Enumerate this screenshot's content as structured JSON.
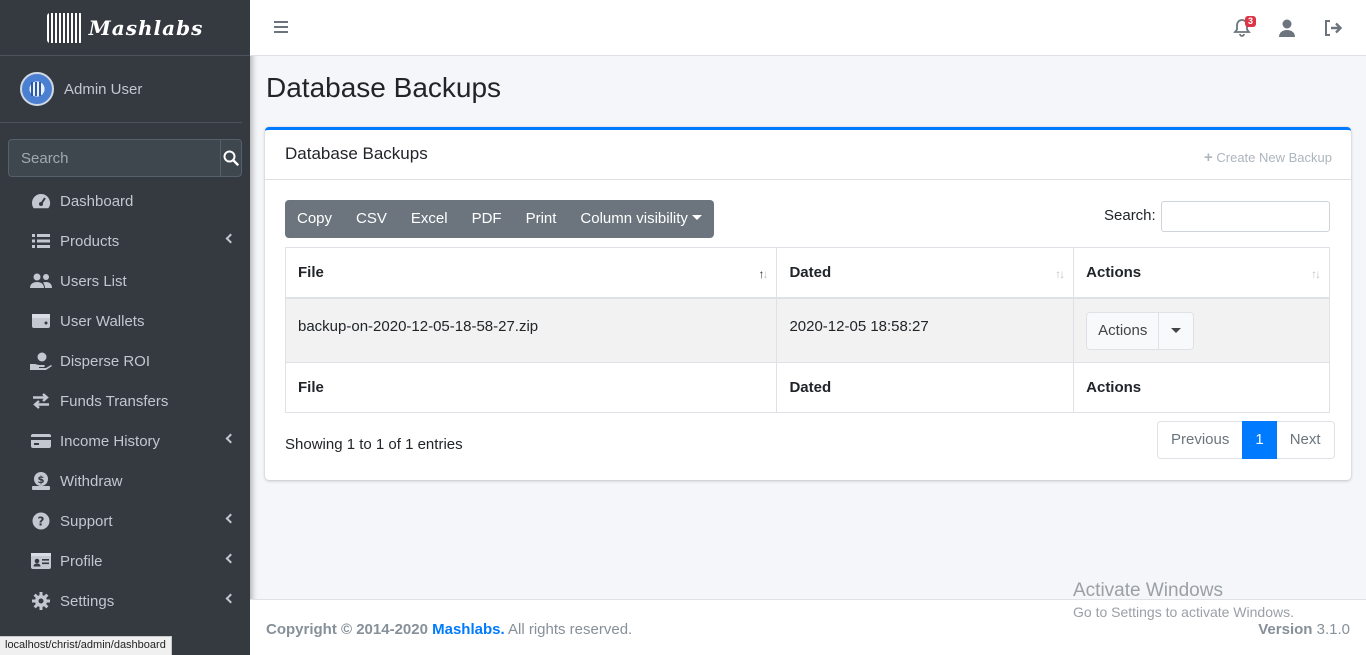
{
  "brand": {
    "name": "Mashlabs"
  },
  "user": {
    "name": "Admin User"
  },
  "sidebar": {
    "search_placeholder": "Search",
    "items": [
      {
        "label": "Dashboard",
        "icon": "tachometer-icon",
        "submenu": false
      },
      {
        "label": "Products",
        "icon": "list-icon",
        "submenu": true
      },
      {
        "label": "Users List",
        "icon": "users-icon",
        "submenu": false
      },
      {
        "label": "User Wallets",
        "icon": "wallet-icon",
        "submenu": false
      },
      {
        "label": "Disperse ROI",
        "icon": "hand-holding-usd-icon",
        "submenu": false
      },
      {
        "label": "Funds Transfers",
        "icon": "exchange-icon",
        "submenu": false
      },
      {
        "label": "Income History",
        "icon": "credit-card-icon",
        "submenu": true
      },
      {
        "label": "Withdraw",
        "icon": "money-bill-icon",
        "submenu": false
      },
      {
        "label": "Support",
        "icon": "question-circle-icon",
        "submenu": true
      },
      {
        "label": "Profile",
        "icon": "id-card-icon",
        "submenu": true
      },
      {
        "label": "Settings",
        "icon": "cog-icon",
        "submenu": true
      }
    ]
  },
  "topbar": {
    "notification_count": "3"
  },
  "page": {
    "title": "Database Backups"
  },
  "card": {
    "title": "Database Backups",
    "create_label": "Create New Backup",
    "buttons": [
      "Copy",
      "CSV",
      "Excel",
      "PDF",
      "Print",
      "Column visibility"
    ],
    "search_label": "Search:",
    "columns": [
      "File",
      "Dated",
      "Actions"
    ],
    "rows": [
      {
        "file": "backup-on-2020-12-05-18-58-27.zip",
        "dated": "2020-12-05 18:58:27",
        "action_label": "Actions"
      }
    ],
    "info": "Showing 1 to 1 of 1 entries",
    "pagination": {
      "previous": "Previous",
      "current": "1",
      "next": "Next"
    }
  },
  "footer": {
    "copyright": "Copyright © 2014-2020",
    "brand": "Mashlabs.",
    "rights": "All rights reserved.",
    "version_label": "Version",
    "version": "3.1.0"
  },
  "watermark": {
    "title": "Activate Windows",
    "subtitle": "Go to Settings to activate Windows."
  },
  "statusbar": {
    "url": "localhost/christ/admin/dashboard"
  },
  "colors": {
    "sidebar": "#343a40",
    "accent": "#007bff",
    "badge": "#dc3545"
  }
}
